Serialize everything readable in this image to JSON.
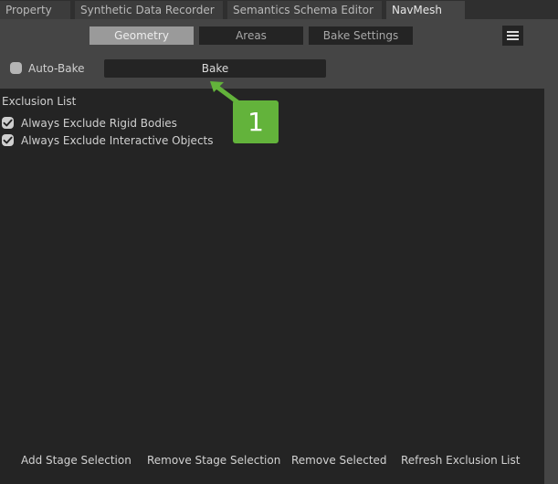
{
  "tabs": [
    {
      "label": "Property"
    },
    {
      "label": "Synthetic Data Recorder"
    },
    {
      "label": "Semantics Schema Editor"
    },
    {
      "label": "NavMesh"
    }
  ],
  "active_tab": "NavMesh",
  "segments": [
    {
      "label": "Geometry"
    },
    {
      "label": "Areas"
    },
    {
      "label": "Bake Settings"
    }
  ],
  "active_segment": "Geometry",
  "auto_bake": {
    "label": "Auto-Bake",
    "checked": false
  },
  "bake_button": {
    "label": "Bake"
  },
  "exclusion": {
    "title": "Exclusion List",
    "options": [
      {
        "label": "Always Exclude Rigid Bodies",
        "checked": true
      },
      {
        "label": "Always Exclude Interactive Objects",
        "checked": true
      }
    ]
  },
  "footer": {
    "add_stage_selection": "Add Stage Selection",
    "remove_stage_selection": "Remove Stage Selection",
    "remove_selected": "Remove Selected",
    "refresh_exclusion_list": "Refresh Exclusion List"
  },
  "callout": {
    "number": "1"
  },
  "colors": {
    "panel_bg": "#454545",
    "list_bg": "#242424",
    "active_segment": "#9a9a9a",
    "callout_green": "#63b33b"
  },
  "icons": [
    "hamburger-menu-icon",
    "checkmark-icon",
    "arrow-icon"
  ]
}
